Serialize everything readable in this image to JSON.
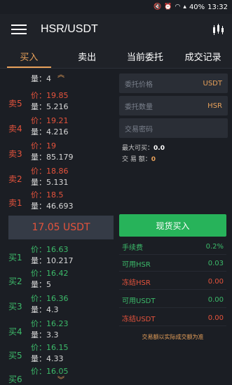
{
  "status_bar": {
    "icons": [
      "mute-icon",
      "alarm-icon",
      "wifi-icon",
      "signal-icon"
    ],
    "battery": "40%",
    "time": "13:32"
  },
  "header": {
    "title": "HSR/USDT",
    "menu_icon": "hamburger-icon",
    "chart_icon": "kline-icon"
  },
  "tabs": [
    {
      "label": "买入",
      "active": true
    },
    {
      "label": "卖出",
      "active": false
    },
    {
      "label": "当前委托",
      "active": false
    },
    {
      "label": "成交记录",
      "active": false
    }
  ],
  "orderbook": {
    "top_partial_qty": "量：4",
    "sells": [
      {
        "label": "卖5",
        "price": "价：19.85",
        "qty": "量：5.216"
      },
      {
        "label": "卖4",
        "price": "价：19.21",
        "qty": "量：4.216"
      },
      {
        "label": "卖3",
        "price": "价：19",
        "qty": "量：85.179"
      },
      {
        "label": "卖2",
        "price": "价：18.86",
        "qty": "量：5.131"
      },
      {
        "label": "卖1",
        "price": "价：18.5",
        "qty": "量：46.693"
      }
    ],
    "mid_price": "17.05 USDT",
    "buys": [
      {
        "label": "买1",
        "price": "价：16.63",
        "qty": "量：10.217"
      },
      {
        "label": "买2",
        "price": "价：16.42",
        "qty": "量：5"
      },
      {
        "label": "买3",
        "price": "价：16.36",
        "qty": "量：4.3"
      },
      {
        "label": "买4",
        "price": "价：16.23",
        "qty": "量：3.3"
      },
      {
        "label": "买5",
        "price": "价：16.15",
        "qty": "量：4.33"
      },
      {
        "label": "买6",
        "price": "价：16.05",
        "qty": ""
      }
    ]
  },
  "form": {
    "price_placeholder": "委托价格",
    "price_unit": "USDT",
    "qty_placeholder": "委托数量",
    "qty_unit": "HSR",
    "password_placeholder": "交易密码",
    "max_buy_label": "最大可买：",
    "max_buy_value": "0.0",
    "amount_label": "交 易 额：",
    "amount_value": "0",
    "submit_label": "现货买入"
  },
  "account": [
    {
      "label": "手续费",
      "value": "0.2%",
      "tone": "green"
    },
    {
      "label": "可用HSR",
      "value": "0.03",
      "tone": "green"
    },
    {
      "label": "冻结HSR",
      "value": "0.00",
      "tone": "red"
    },
    {
      "label": "可用USDT",
      "value": "0.00",
      "tone": "green"
    },
    {
      "label": "冻结USDT",
      "value": "0.00",
      "tone": "red"
    }
  ],
  "note": "交易额以实际成交额为准",
  "colors": {
    "sell": "#e5533c",
    "buy": "#3cbb6a",
    "accent": "#e8a15a",
    "button": "#27b35a"
  }
}
